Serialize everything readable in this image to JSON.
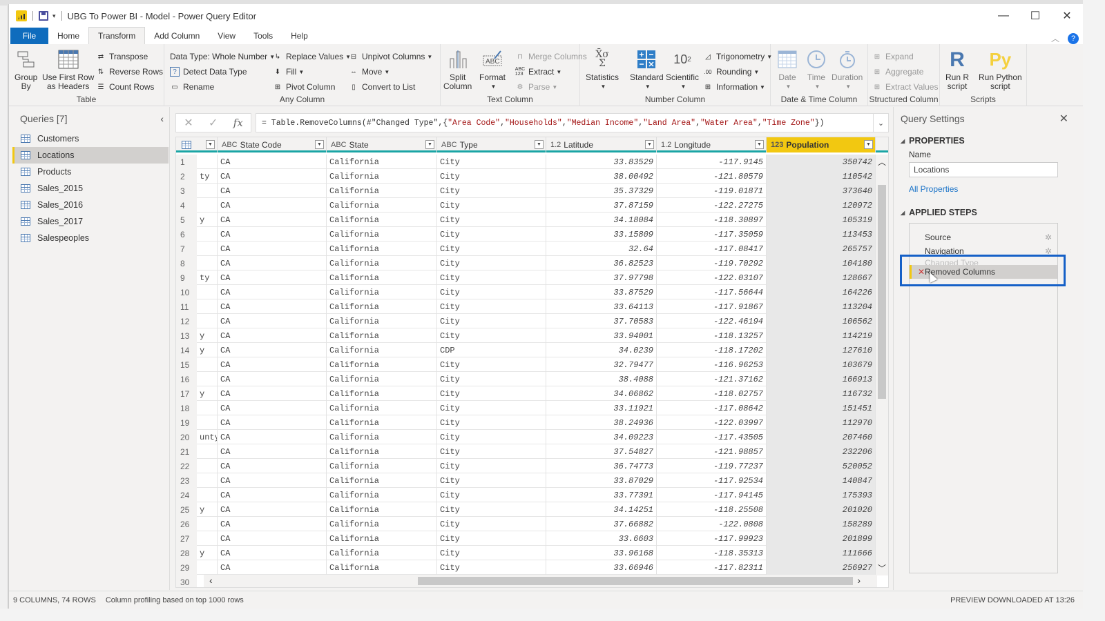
{
  "window": {
    "title": "UBG To Power BI - Model - Power Query Editor",
    "controls": [
      "minimize",
      "maximize",
      "close"
    ]
  },
  "tabs": [
    {
      "label": "File",
      "active": false
    },
    {
      "label": "Home",
      "active": false
    },
    {
      "label": "Transform",
      "active": true
    },
    {
      "label": "Add Column",
      "active": false
    },
    {
      "label": "View",
      "active": false
    },
    {
      "label": "Tools",
      "active": false
    },
    {
      "label": "Help",
      "active": false
    }
  ],
  "ribbon": {
    "table": {
      "label": "Table",
      "group_by": "Group\nBy",
      "use_first_row": "Use First Row\nas Headers",
      "transpose": "Transpose",
      "reverse_rows": "Reverse Rows",
      "count_rows": "Count Rows"
    },
    "any_column": {
      "label": "Any Column",
      "data_type": "Data Type: Whole Number",
      "detect_data_type": "Detect Data Type",
      "rename": "Rename",
      "replace_values": "Replace Values",
      "fill": "Fill",
      "pivot_column": "Pivot Column",
      "unpivot_columns": "Unpivot Columns",
      "move": "Move",
      "convert_to_list": "Convert to List"
    },
    "text_column": {
      "label": "Text Column",
      "split_column": "Split\nColumn",
      "format": "Format",
      "merge_columns": "Merge Columns",
      "extract": "Extract",
      "parse": "Parse"
    },
    "number_column": {
      "label": "Number Column",
      "statistics": "Statistics",
      "standard": "Standard",
      "scientific": "Scientific",
      "trigonometry": "Trigonometry",
      "rounding": "Rounding",
      "information": "Information"
    },
    "date_time_column": {
      "label": "Date & Time Column",
      "date": "Date",
      "time": "Time",
      "duration": "Duration"
    },
    "structured_column": {
      "label": "Structured Column",
      "expand": "Expand",
      "aggregate": "Aggregate",
      "extract_values": "Extract Values"
    },
    "scripts": {
      "label": "Scripts",
      "run_r": "Run R\nscript",
      "run_python": "Run Python\nscript"
    }
  },
  "queries": {
    "header": "Queries [7]",
    "items": [
      {
        "label": "Customers",
        "selected": false
      },
      {
        "label": "Locations",
        "selected": true
      },
      {
        "label": "Products",
        "selected": false
      },
      {
        "label": "Sales_2015",
        "selected": false
      },
      {
        "label": "Sales_2016",
        "selected": false
      },
      {
        "label": "Sales_2017",
        "selected": false
      },
      {
        "label": "Salespeoples",
        "selected": false
      }
    ]
  },
  "formula": {
    "prefix": "= Table.RemoveColumns(#\"Changed Type\",{",
    "strings": [
      "\"Area Code\"",
      "\"Households\"",
      "\"Median Income\"",
      "\"Land Area\"",
      "\"Water Area\"",
      "\"Time Zone\""
    ],
    "suffix": "})"
  },
  "grid": {
    "columns": [
      {
        "type": "",
        "label": ""
      },
      {
        "type": "ABC",
        "label": "State Code"
      },
      {
        "type": "ABC",
        "label": "State"
      },
      {
        "type": "ABC",
        "label": "Type"
      },
      {
        "type": "1.2",
        "label": "Latitude"
      },
      {
        "type": "1.2",
        "label": "Longitude"
      },
      {
        "type": "123",
        "label": "Population",
        "selected": true
      }
    ],
    "rows": [
      [
        "1",
        "",
        "CA",
        "California",
        "City",
        "33.83529",
        "-117.9145",
        "350742"
      ],
      [
        "2",
        "ty",
        "CA",
        "California",
        "City",
        "38.00492",
        "-121.80579",
        "110542"
      ],
      [
        "3",
        "",
        "CA",
        "California",
        "City",
        "35.37329",
        "-119.01871",
        "373640"
      ],
      [
        "4",
        "",
        "CA",
        "California",
        "City",
        "37.87159",
        "-122.27275",
        "120972"
      ],
      [
        "5",
        "y",
        "CA",
        "California",
        "City",
        "34.18084",
        "-118.30897",
        "105319"
      ],
      [
        "6",
        "",
        "CA",
        "California",
        "City",
        "33.15809",
        "-117.35059",
        "113453"
      ],
      [
        "7",
        "",
        "CA",
        "California",
        "City",
        "32.64",
        "-117.08417",
        "265757"
      ],
      [
        "8",
        "",
        "CA",
        "California",
        "City",
        "36.82523",
        "-119.70292",
        "104180"
      ],
      [
        "9",
        "ty",
        "CA",
        "California",
        "City",
        "37.97798",
        "-122.03107",
        "128667"
      ],
      [
        "10",
        "",
        "CA",
        "California",
        "City",
        "33.87529",
        "-117.56644",
        "164226"
      ],
      [
        "11",
        "",
        "CA",
        "California",
        "City",
        "33.64113",
        "-117.91867",
        "113204"
      ],
      [
        "12",
        "",
        "CA",
        "California",
        "City",
        "37.70583",
        "-122.46194",
        "106562"
      ],
      [
        "13",
        "y",
        "CA",
        "California",
        "City",
        "33.94001",
        "-118.13257",
        "114219"
      ],
      [
        "14",
        "y",
        "CA",
        "California",
        "CDP",
        "34.0239",
        "-118.17202",
        "127610"
      ],
      [
        "15",
        "",
        "CA",
        "California",
        "City",
        "32.79477",
        "-116.96253",
        "103679"
      ],
      [
        "16",
        "",
        "CA",
        "California",
        "City",
        "38.4088",
        "-121.37162",
        "166913"
      ],
      [
        "17",
        "y",
        "CA",
        "California",
        "City",
        "34.06862",
        "-118.02757",
        "116732"
      ],
      [
        "18",
        "",
        "CA",
        "California",
        "City",
        "33.11921",
        "-117.08642",
        "151451"
      ],
      [
        "19",
        "",
        "CA",
        "California",
        "City",
        "38.24936",
        "-122.03997",
        "112970"
      ],
      [
        "20",
        "unty",
        "CA",
        "California",
        "City",
        "34.09223",
        "-117.43505",
        "207460"
      ],
      [
        "21",
        "",
        "CA",
        "California",
        "City",
        "37.54827",
        "-121.98857",
        "232206"
      ],
      [
        "22",
        "",
        "CA",
        "California",
        "City",
        "36.74773",
        "-119.77237",
        "520052"
      ],
      [
        "23",
        "",
        "CA",
        "California",
        "City",
        "33.87029",
        "-117.92534",
        "140847"
      ],
      [
        "24",
        "",
        "CA",
        "California",
        "City",
        "33.77391",
        "-117.94145",
        "175393"
      ],
      [
        "25",
        "y",
        "CA",
        "California",
        "City",
        "34.14251",
        "-118.25508",
        "201020"
      ],
      [
        "26",
        "",
        "CA",
        "California",
        "City",
        "37.66882",
        "-122.0808",
        "158289"
      ],
      [
        "27",
        "",
        "CA",
        "California",
        "City",
        "33.6603",
        "-117.99923",
        "201899"
      ],
      [
        "28",
        "y",
        "CA",
        "California",
        "City",
        "33.96168",
        "-118.35313",
        "111666"
      ],
      [
        "29",
        "",
        "CA",
        "California",
        "City",
        "33.66946",
        "-117.82311",
        "256927"
      ],
      [
        "30",
        "",
        "",
        "",
        "",
        "",
        "",
        ""
      ]
    ]
  },
  "settings": {
    "header": "Query Settings",
    "properties_label": "PROPERTIES",
    "name_label": "Name",
    "name_value": "Locations",
    "all_properties": "All Properties",
    "applied_steps_label": "APPLIED STEPS",
    "steps": [
      {
        "label": "Source",
        "gear": true
      },
      {
        "label": "Navigation",
        "gear": true
      },
      {
        "label": "Changed Type",
        "faded": true
      },
      {
        "label": "Removed Columns",
        "selected": true
      }
    ]
  },
  "status": {
    "left": "9 COLUMNS, 74 ROWS",
    "profiling": "Column profiling based on top 1000 rows",
    "right": "PREVIEW DOWNLOADED AT 13:26"
  },
  "colors": {
    "accent_yellow": "#f2c811",
    "file_tab": "#0f6cbd",
    "header_underline": "#1aa5a5",
    "highlight_box": "#1560c7",
    "formula_string": "#a31515"
  }
}
